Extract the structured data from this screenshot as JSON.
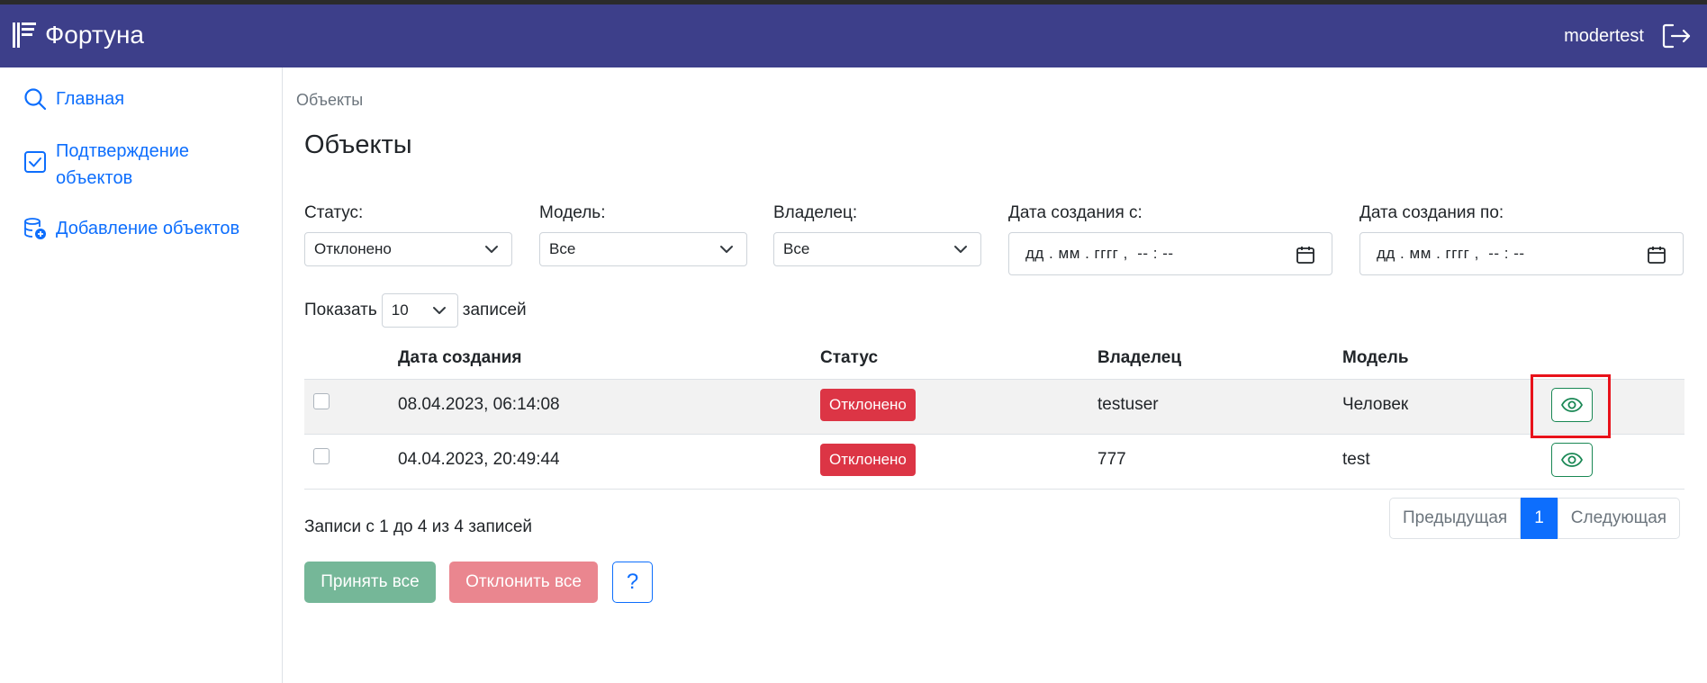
{
  "header": {
    "brand": "Фортуна",
    "username": "modertest",
    "colors": {
      "navbar": "#3d3f8a"
    }
  },
  "sidebar": {
    "items": [
      {
        "label": "Главная",
        "icon": "search-icon"
      },
      {
        "label": "Подтверждение объектов",
        "icon": "checkbox-icon"
      },
      {
        "label": "Добавление объектов",
        "icon": "database-add-icon"
      }
    ]
  },
  "breadcrumb": "Объекты",
  "page_title": "Объекты",
  "filters": {
    "status": {
      "label": "Статус:",
      "value": "Отклонено"
    },
    "model": {
      "label": "Модель:",
      "value": "Все"
    },
    "owner": {
      "label": "Владелец:",
      "value": "Все"
    },
    "date_from": {
      "label": "Дата создания с:",
      "placeholder": "дд . мм . гггг ,  -- : --"
    },
    "date_to": {
      "label": "Дата создания по:",
      "placeholder": "дд . мм . гггг ,  -- : --"
    }
  },
  "length": {
    "prefix": "Показать",
    "value": "10",
    "suffix": "записей"
  },
  "table": {
    "columns": [
      "",
      "Дата создания",
      "Статус",
      "Владелец",
      "Модель",
      ""
    ],
    "rows": [
      {
        "date": "08.04.2023, 06:14:08",
        "status": "Отклонено",
        "owner": "testuser",
        "model": "Человек"
      },
      {
        "date": "04.04.2023, 20:49:44",
        "status": "Отклонено",
        "owner": "777",
        "model": "test"
      }
    ]
  },
  "info": "Записи с 1 до 4 из 4 записей",
  "pagination": {
    "prev": "Предыдущая",
    "current": "1",
    "next": "Следующая"
  },
  "actions": {
    "accept_all": "Принять все",
    "reject_all": "Отклонить все",
    "help": "?"
  }
}
